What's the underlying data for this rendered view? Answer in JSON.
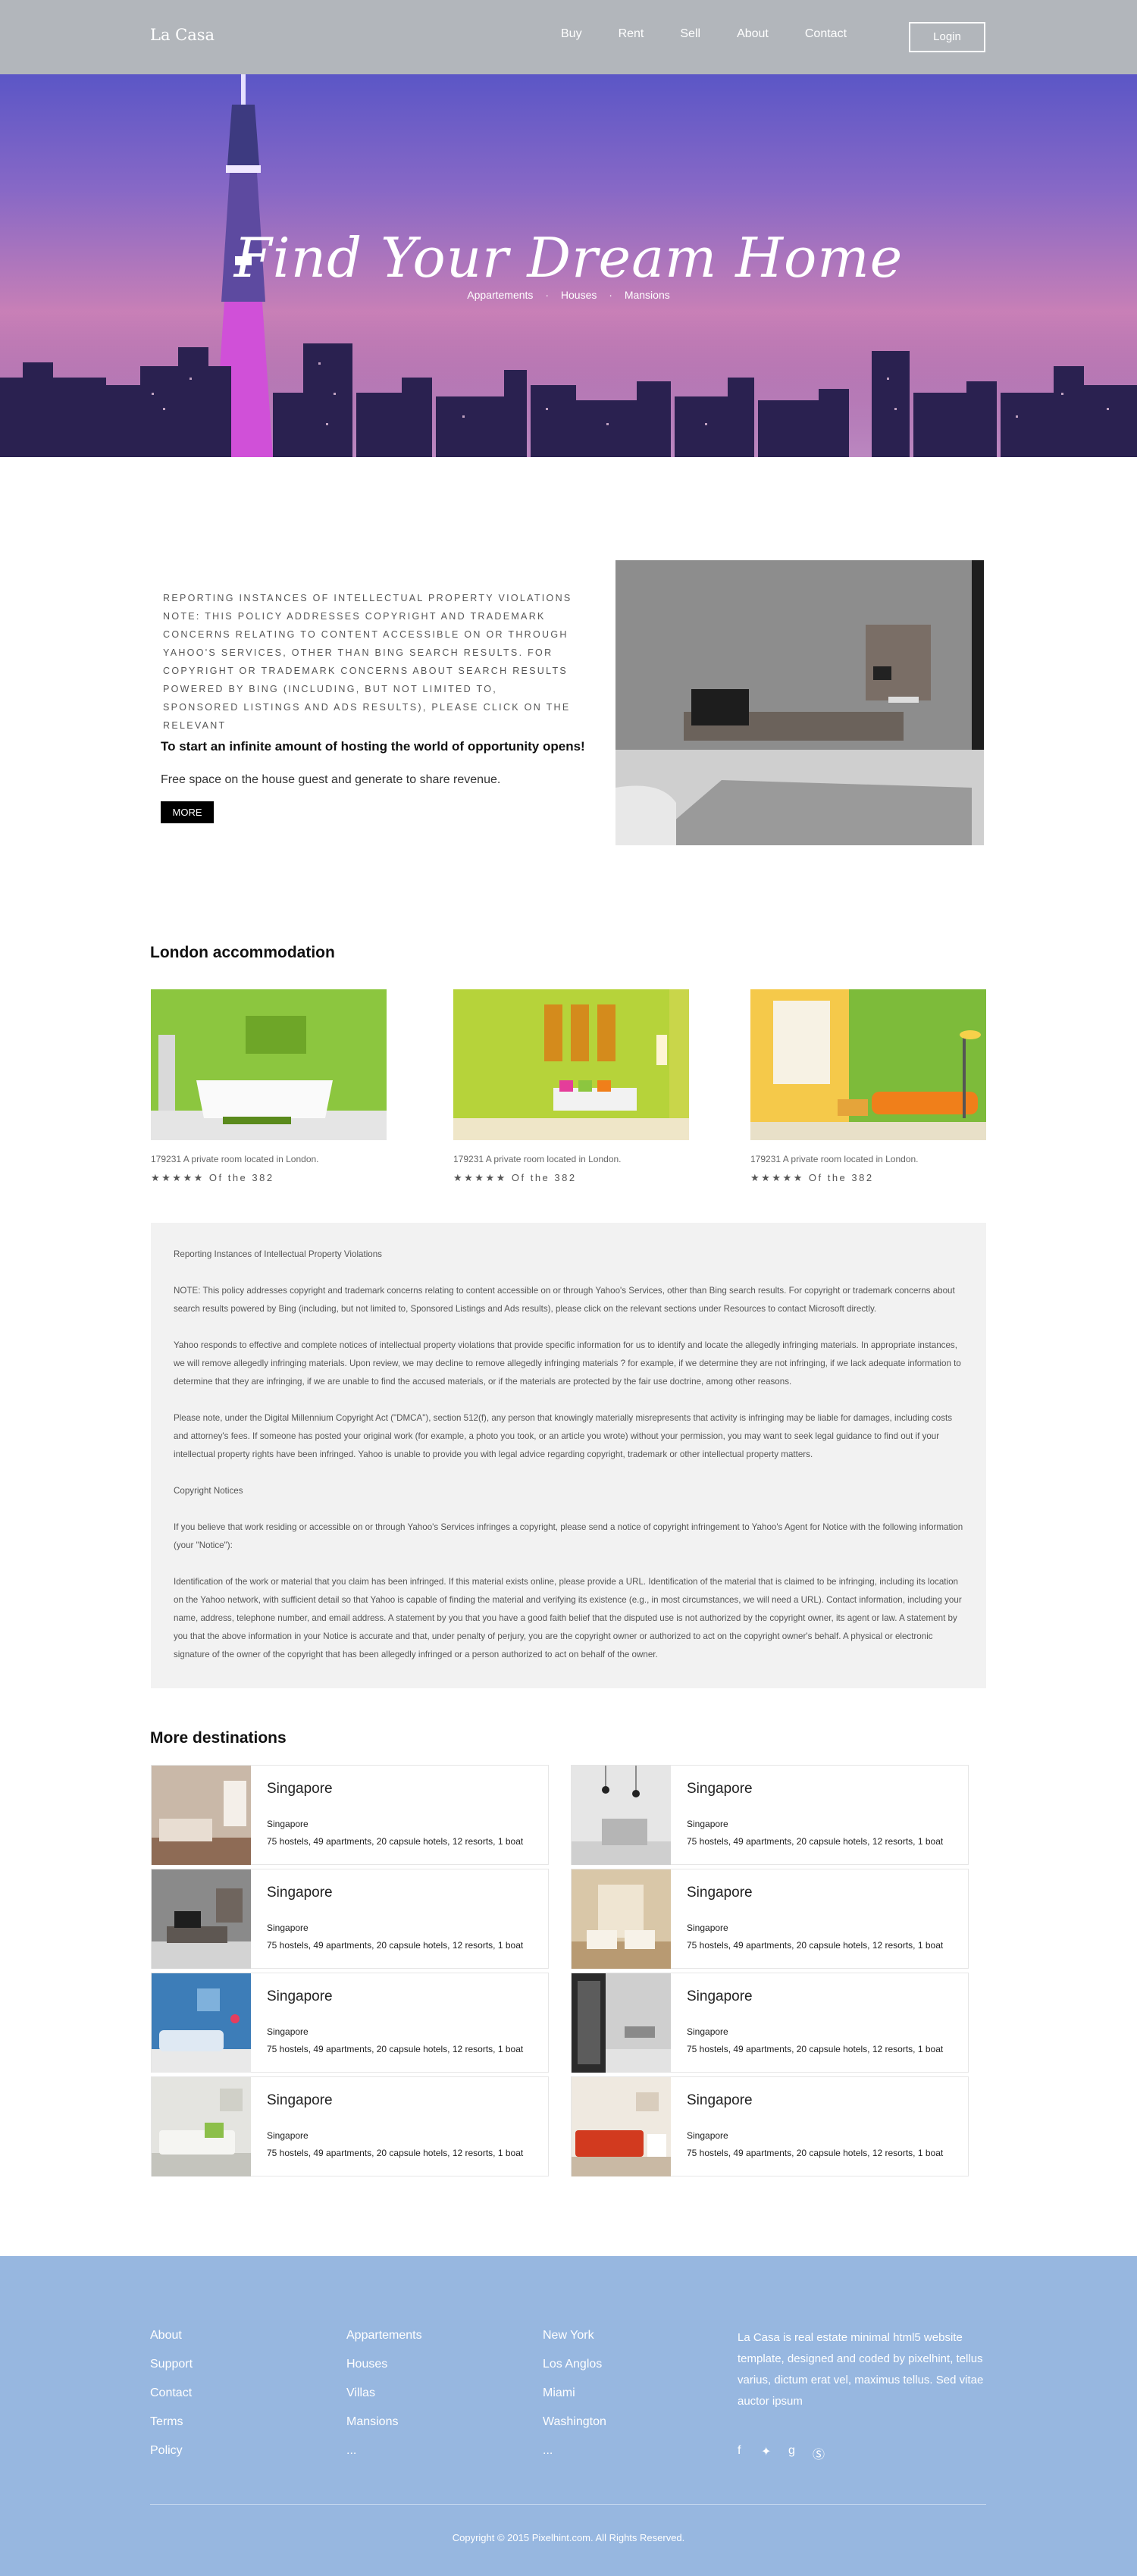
{
  "header": {
    "brand": "La Casa",
    "nav": [
      "Buy",
      "Rent",
      "Sell",
      "About",
      "Contact"
    ],
    "login_label": "Login"
  },
  "hero": {
    "title": "Find Your Dream Home",
    "subtitle": [
      "Appartements",
      "·",
      "Houses",
      "·",
      "Mansions"
    ]
  },
  "intro": {
    "text": "Reporting Instances of Intellectual Property Violations NOTE: This policy addresses copyright and trademark concerns relating to content accessible on or through Yahoo's Services, other than Bing search results. For copyright or trademark concerns about search results powered by Bing (including, but not limited to, Sponsored Listings and Ads results), please click on the relevant",
    "bold": "To start an infinite amount of hosting the world of opportunity opens!",
    "plain": "Free space on the house guest and generate to share revenue.",
    "more_label": "MORE"
  },
  "london": {
    "title": "London accommodation",
    "cards": [
      {
        "caption": "179231  A private room located in London.",
        "rating": "★★★★★  Of the 382"
      },
      {
        "caption": "179231  A private room located in London.",
        "rating": "★★★★★  Of the 382"
      },
      {
        "caption": "179231  A private room located in London.",
        "rating": "★★★★★  Of the 382"
      }
    ]
  },
  "notice": {
    "paragraphs": [
      "Reporting Instances of Intellectual Property Violations",
      "NOTE: This policy addresses copyright and trademark concerns relating to content accessible on or through Yahoo's Services, other than Bing search results. For copyright or trademark concerns about search results powered by Bing (including, but not limited to, Sponsored Listings and Ads results), please click on the relevant sections under Resources to contact Microsoft directly.",
      "Yahoo responds to effective and complete notices of intellectual property violations that provide specific information for us to identify and locate the allegedly infringing materials. In appropriate instances, we will remove allegedly infringing materials. Upon review, we may decline to remove allegedly infringing materials ? for example, if we determine they are not infringing, if we lack adequate information to determine that they are infringing, if we are unable to find the accused materials, or if the materials are protected by the fair use doctrine, among other reasons.",
      "Please note, under the Digital Millennium Copyright Act (\"DMCA\"), section 512(f), any person that knowingly materially misrepresents that activity is infringing may be liable for damages, including costs and attorney's fees. If someone has posted your original work (for example, a photo you took, or an article you wrote) without your permission, you may want to seek legal guidance to find out if your intellectual property rights have been infringed. Yahoo is unable to provide you with legal advice regarding copyright, trademark or other intellectual property matters.",
      "Copyright Notices",
      "If you believe that work residing or accessible on or through Yahoo's Services infringes a copyright, please send a notice of copyright infringement to Yahoo's Agent for Notice with the following information (your \"Notice\"):",
      "Identification of the work or material that you claim has been infringed. If this material exists online, please provide a URL. Identification of the material that is claimed to be infringing, including its location on the Yahoo network, with sufficient detail so that Yahoo is capable of finding the material and verifying its existence (e.g., in most circumstances, we will need a URL). Contact information, including your name, address, telephone number, and email address. A statement by you that you have a good faith belief that the disputed use is not authorized by the copyright owner, its agent or law. A statement by you that the above information in your Notice is accurate and that, under penalty of perjury, you are the copyright owner or authorized to act on the copyright owner's behalf. A physical or electronic signature of the owner of the copyright that has been allegedly infringed or a person authorized to act on behalf of the owner."
    ]
  },
  "destinations": {
    "title": "More destinations",
    "items": [
      {
        "name": "Singapore",
        "sub": "Singapore",
        "desc": "75 hostels, 49 apartments, 20 capsule hotels, 12 resorts, 1 boat"
      },
      {
        "name": "Singapore",
        "sub": "Singapore",
        "desc": "75 hostels, 49 apartments, 20 capsule hotels, 12 resorts, 1 boat"
      },
      {
        "name": "Singapore",
        "sub": "Singapore",
        "desc": "75 hostels, 49 apartments, 20 capsule hotels, 12 resorts, 1 boat"
      },
      {
        "name": "Singapore",
        "sub": "Singapore",
        "desc": "75 hostels, 49 apartments, 20 capsule hotels, 12 resorts, 1 boat"
      },
      {
        "name": "Singapore",
        "sub": "Singapore",
        "desc": "75 hostels, 49 apartments, 20 capsule hotels, 12 resorts, 1 boat"
      },
      {
        "name": "Singapore",
        "sub": "Singapore",
        "desc": "75 hostels, 49 apartments, 20 capsule hotels, 12 resorts, 1 boat"
      },
      {
        "name": "Singapore",
        "sub": "Singapore",
        "desc": "75 hostels, 49 apartments, 20 capsule hotels, 12 resorts, 1 boat"
      },
      {
        "name": "Singapore",
        "sub": "Singapore",
        "desc": "75 hostels, 49 apartments, 20 capsule hotels, 12 resorts, 1 boat"
      }
    ]
  },
  "footer": {
    "col1": [
      "About",
      "Support",
      "Contact",
      "Terms",
      "Policy"
    ],
    "col2": [
      "Appartements",
      "Houses",
      "Villas",
      "Mansions",
      "..."
    ],
    "col3": [
      "New York",
      "Los Anglos",
      "Miami",
      "Washington",
      "..."
    ],
    "about": "La Casa is real estate minimal html5 website template, designed and coded by pixelhint, tellus varius, dictum erat vel, maximus tellus. Sed vitae auctor ipsum",
    "social_icons": [
      "facebook-icon",
      "twitter-icon",
      "google-plus-icon",
      "skype-icon"
    ],
    "copyright": "Copyright © 2015 Pixelhint.com. All Rights Reserved."
  },
  "colors": {
    "header_bg": "#b2b6bb",
    "footer_bg": "#97b7e0",
    "notice_bg": "#f2f2f2",
    "button_bg": "#000000"
  }
}
